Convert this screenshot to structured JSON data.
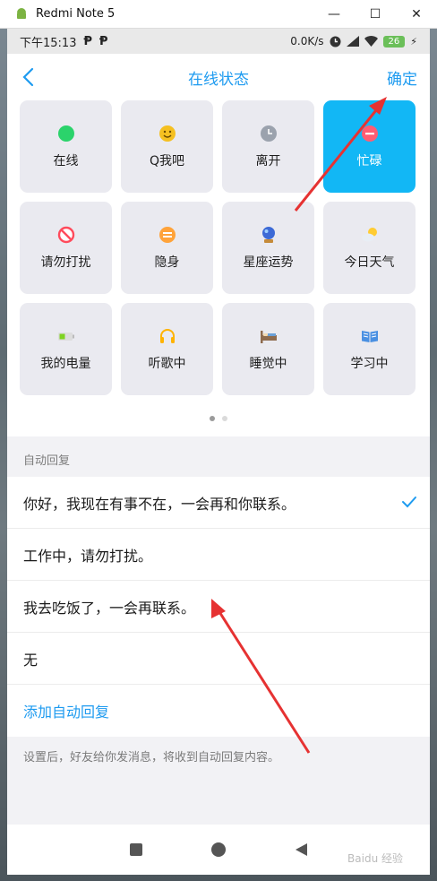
{
  "window": {
    "title": "Redmi Note 5",
    "buttons": [
      "—",
      "☐",
      "✕"
    ]
  },
  "statusbar": {
    "time": "下午15:13",
    "speed": "0.0K/s",
    "battery": "26"
  },
  "header": {
    "back_icon": "chevron-left-icon",
    "title": "在线状态",
    "confirm": "确定"
  },
  "statuses": [
    {
      "label": "在线",
      "icon": "green-dot-icon",
      "color": "#2bd36b",
      "active": false
    },
    {
      "label": "Q我吧",
      "icon": "smile-face-icon",
      "color": "#f5c021",
      "active": false
    },
    {
      "label": "离开",
      "icon": "clock-icon",
      "color": "#9ba2ad",
      "active": false
    },
    {
      "label": "忙碌",
      "icon": "busy-minus-icon",
      "color": "#ff5d73",
      "active": true
    },
    {
      "label": "请勿打扰",
      "icon": "no-entry-icon",
      "color": "#ff4b5c",
      "active": false
    },
    {
      "label": "隐身",
      "icon": "hidden-icon",
      "color": "#ffa33a",
      "active": false
    },
    {
      "label": "星座运势",
      "icon": "crystal-ball-icon",
      "color": "#3d6ad6",
      "active": false
    },
    {
      "label": "今日天气",
      "icon": "weather-icon",
      "color": "#ffcc33",
      "active": false
    },
    {
      "label": "我的电量",
      "icon": "battery-icon",
      "color": "#7ed321",
      "active": false
    },
    {
      "label": "听歌中",
      "icon": "headphones-icon",
      "color": "#ffb300",
      "active": false
    },
    {
      "label": "睡觉中",
      "icon": "bed-icon",
      "color": "#8e6b4e",
      "active": false
    },
    {
      "label": "学习中",
      "icon": "book-icon",
      "color": "#4a90e2",
      "active": false
    }
  ],
  "auto_reply": {
    "section_label": "自动回复",
    "items": [
      {
        "text": "你好，我现在有事不在，一会再和你联系。",
        "selected": true
      },
      {
        "text": "工作中，请勿打扰。",
        "selected": false
      },
      {
        "text": "我去吃饭了，一会再联系。",
        "selected": false
      },
      {
        "text": "无",
        "selected": false
      }
    ],
    "add_label": "添加自动回复",
    "footnote": "设置后，好友给你发消息，将收到自动回复内容。"
  },
  "watermark": "Baidu 经验"
}
